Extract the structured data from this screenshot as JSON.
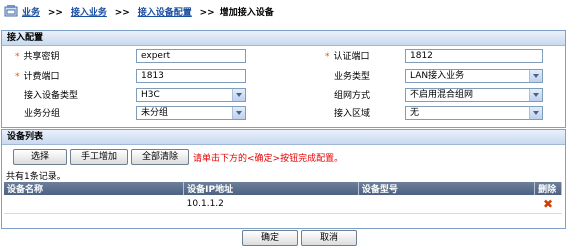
{
  "breadcrumb": {
    "items": [
      "业务",
      "接入业务",
      "接入设备配置"
    ],
    "current": "增加接入设备",
    "separator": ">>"
  },
  "config": {
    "title": "接入配置",
    "shared_key": {
      "label": "共享密钥",
      "value": "expert"
    },
    "auth_port": {
      "label": "认证端口",
      "value": "1812"
    },
    "acct_port": {
      "label": "计费端口",
      "value": "1813"
    },
    "service_type": {
      "label": "业务类型",
      "value": "LAN接入业务"
    },
    "device_type": {
      "label": "接入设备类型",
      "value": "H3C"
    },
    "network_mode": {
      "label": "组网方式",
      "value": "不启用混合组网"
    },
    "service_group": {
      "label": "业务分组",
      "value": "未分组"
    },
    "access_area": {
      "label": "接入区域",
      "value": "无"
    }
  },
  "device_list": {
    "title": "设备列表",
    "buttons": {
      "select": "选择",
      "manual_add": "手工增加",
      "clear_all": "全部清除"
    },
    "hint": "请单击下方的<确定>按钮完成配置。",
    "record_count": "共有1条记录。",
    "columns": [
      "设备名称",
      "设备IP地址",
      "设备型号",
      "删除"
    ],
    "rows": [
      {
        "name": "",
        "ip": "10.1.1.2",
        "model": ""
      }
    ]
  },
  "footer": {
    "ok": "确定",
    "cancel": "取消"
  },
  "icons": {
    "breadcrumb_icon": "home-icon",
    "delete_icon": "delete-x-icon"
  },
  "colors": {
    "link": "#1a4ea0",
    "hint": "#e60000",
    "star": "#e05a00",
    "delete": "#d53c00"
  }
}
